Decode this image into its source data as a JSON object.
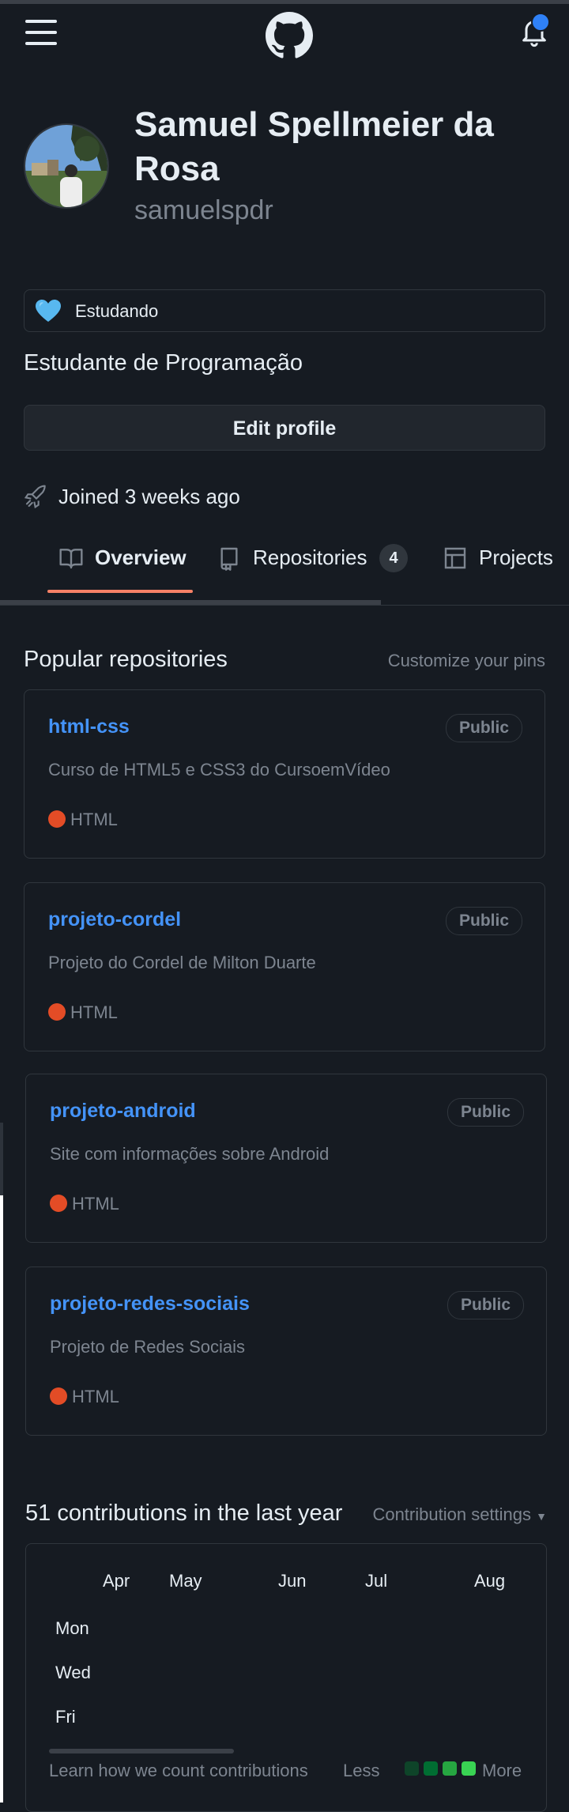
{
  "profile": {
    "name": "Samuel Spellmeier da Rosa",
    "login": "samuelspdr",
    "status_emoji": "blue-heart-icon",
    "status_text": "Estudando",
    "bio": "Estudante de Programação",
    "edit_label": "Edit profile",
    "joined": "Joined 3 weeks ago"
  },
  "tabs": {
    "overview": "Overview",
    "repositories": "Repositories",
    "repositories_count": "4",
    "projects": "Projects"
  },
  "pinned": {
    "title": "Popular repositories",
    "customize": "Customize your pins",
    "repos": [
      {
        "name": "html-css",
        "visibility": "Public",
        "description": "Curso de HTML5 e CSS3 do CursoemVídeo",
        "language": "HTML"
      },
      {
        "name": "projeto-cordel",
        "visibility": "Public",
        "description": "Projeto do Cordel de Milton Duarte",
        "language": "HTML"
      },
      {
        "name": "projeto-android",
        "visibility": "Public",
        "description": "Site com informações sobre Android",
        "language": "HTML"
      },
      {
        "name": "projeto-redes-sociais",
        "visibility": "Public",
        "description": "Projeto de Redes Sociais",
        "language": "HTML"
      }
    ]
  },
  "contributions": {
    "title": "51 contributions in the last year",
    "settings": "Contribution settings",
    "months": [
      "Apr",
      "May",
      "Jun",
      "Jul",
      "Aug"
    ],
    "days": [
      "Mon",
      "Wed",
      "Fri"
    ],
    "learn": "Learn how we count contributions",
    "less": "Less",
    "more": "More",
    "legend_colors": [
      "#161b22",
      "#0e4429",
      "#006d32",
      "#26a641",
      "#39d353"
    ]
  },
  "colors": {
    "background": "#161b22",
    "link": "#4493f8",
    "tab_underline": "#f78166",
    "html_language": "#e34c26",
    "notification_dot": "#2f81f7"
  }
}
